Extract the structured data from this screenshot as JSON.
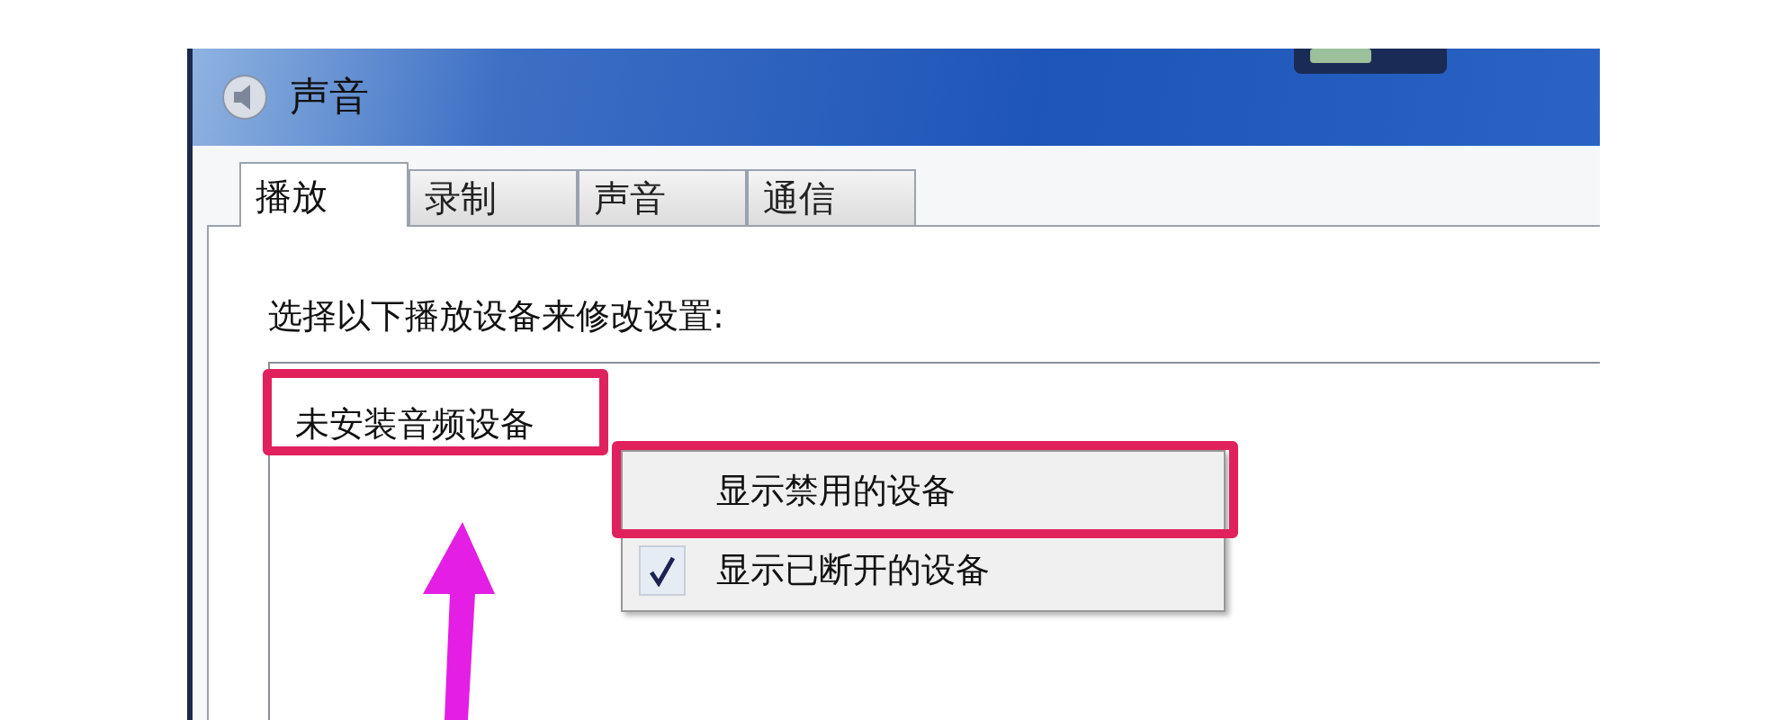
{
  "window": {
    "title": "声音"
  },
  "tabs": [
    {
      "label": "播放",
      "selected": true
    },
    {
      "label": "录制",
      "selected": false
    },
    {
      "label": "声音",
      "selected": false
    },
    {
      "label": "通信",
      "selected": false
    }
  ],
  "instruction": "选择以下播放设备来修改设置:",
  "device_list": {
    "empty_text": "未安装音频设备",
    "annotated": true
  },
  "context_menu": {
    "items": [
      {
        "label": "显示禁用的设备",
        "checked": false,
        "annotated": true
      },
      {
        "label": "显示已断开的设备",
        "checked": true,
        "annotated": false
      }
    ]
  }
}
